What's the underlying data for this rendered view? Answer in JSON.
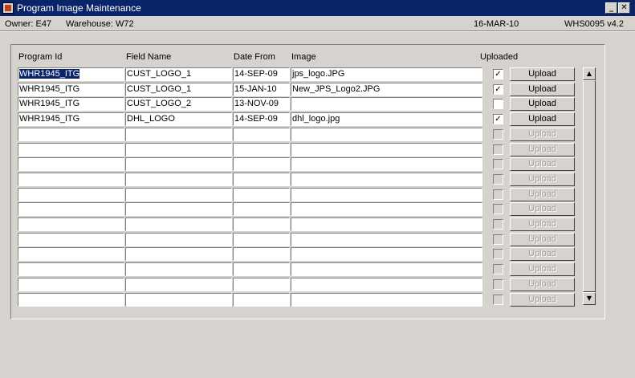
{
  "window": {
    "title": "Program Image Maintenance",
    "minimize_label": "_",
    "close_label": "✕"
  },
  "status": {
    "owner": "Owner:  E47",
    "warehouse": "Warehouse:  W72",
    "date": "16-MAR-10",
    "version": "WHS0095  v4.2"
  },
  "columns": {
    "program_id": "Program Id",
    "field_name": "Field Name",
    "date_from": "Date From",
    "image": "Image",
    "uploaded": "Uploaded"
  },
  "upload_label": "Upload",
  "rows": [
    {
      "program_id": "WHR1945_ITG",
      "field_name": "CUST_LOGO_1",
      "date_from": "14-SEP-09",
      "image": "jps_logo.JPG",
      "uploaded": true,
      "enabled": true
    },
    {
      "program_id": "WHR1945_ITG",
      "field_name": "CUST_LOGO_1",
      "date_from": "15-JAN-10",
      "image": "New_JPS_Logo2.JPG",
      "uploaded": true,
      "enabled": true
    },
    {
      "program_id": "WHR1945_ITG",
      "field_name": "CUST_LOGO_2",
      "date_from": "13-NOV-09",
      "image": "",
      "uploaded": false,
      "enabled": true
    },
    {
      "program_id": "WHR1945_ITG",
      "field_name": "DHL_LOGO",
      "date_from": "14-SEP-09",
      "image": "dhl_logo.jpg",
      "uploaded": true,
      "enabled": true
    },
    {
      "program_id": "",
      "field_name": "",
      "date_from": "",
      "image": "",
      "uploaded": false,
      "enabled": false
    },
    {
      "program_id": "",
      "field_name": "",
      "date_from": "",
      "image": "",
      "uploaded": false,
      "enabled": false
    },
    {
      "program_id": "",
      "field_name": "",
      "date_from": "",
      "image": "",
      "uploaded": false,
      "enabled": false
    },
    {
      "program_id": "",
      "field_name": "",
      "date_from": "",
      "image": "",
      "uploaded": false,
      "enabled": false
    },
    {
      "program_id": "",
      "field_name": "",
      "date_from": "",
      "image": "",
      "uploaded": false,
      "enabled": false
    },
    {
      "program_id": "",
      "field_name": "",
      "date_from": "",
      "image": "",
      "uploaded": false,
      "enabled": false
    },
    {
      "program_id": "",
      "field_name": "",
      "date_from": "",
      "image": "",
      "uploaded": false,
      "enabled": false
    },
    {
      "program_id": "",
      "field_name": "",
      "date_from": "",
      "image": "",
      "uploaded": false,
      "enabled": false
    },
    {
      "program_id": "",
      "field_name": "",
      "date_from": "",
      "image": "",
      "uploaded": false,
      "enabled": false
    },
    {
      "program_id": "",
      "field_name": "",
      "date_from": "",
      "image": "",
      "uploaded": false,
      "enabled": false
    },
    {
      "program_id": "",
      "field_name": "",
      "date_from": "",
      "image": "",
      "uploaded": false,
      "enabled": false
    },
    {
      "program_id": "",
      "field_name": "",
      "date_from": "",
      "image": "",
      "uploaded": false,
      "enabled": false
    }
  ],
  "icons": {
    "app": "app-icon",
    "minimize": "minimize-icon",
    "close": "close-icon",
    "scroll_up": "arrow-up-icon",
    "scroll_down": "arrow-down-icon",
    "check": "checkmark-icon"
  }
}
